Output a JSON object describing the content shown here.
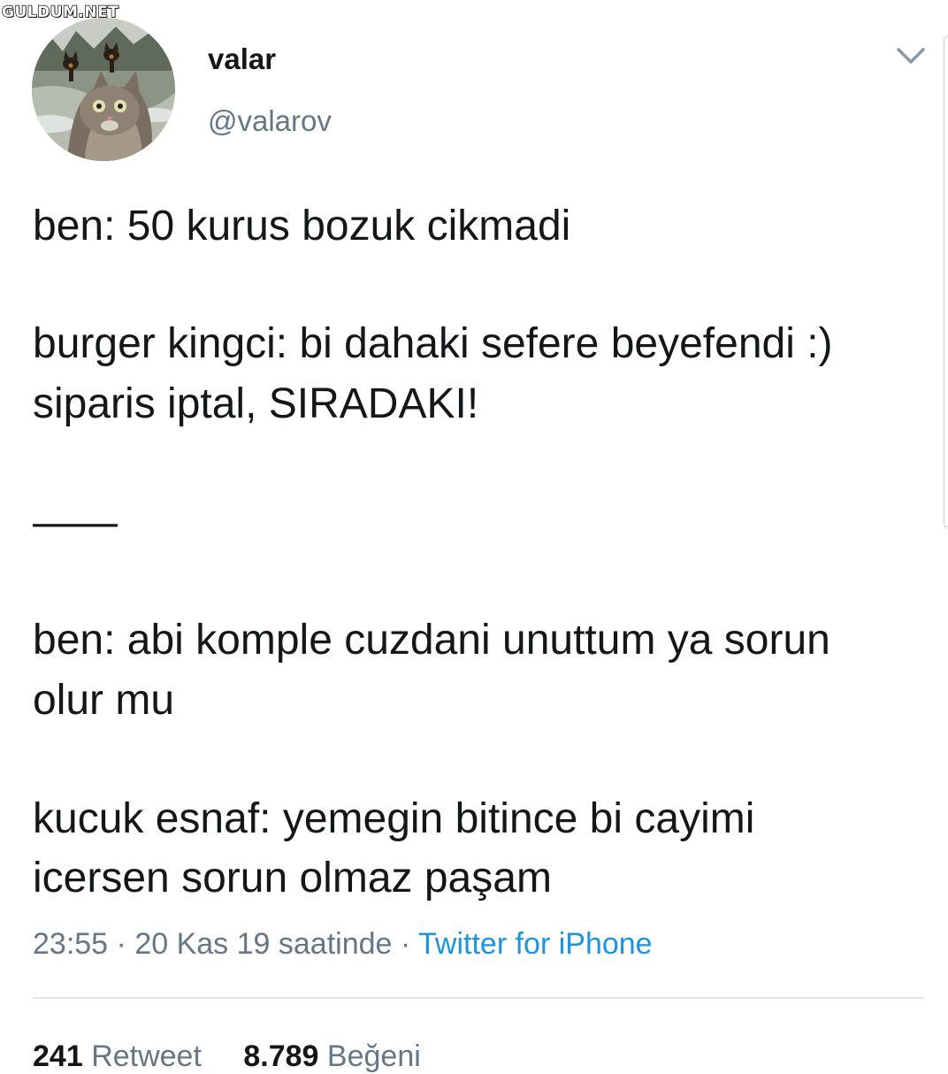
{
  "watermark": "GULDUM.NET",
  "user": {
    "display_name": "valar",
    "handle": "@valarov",
    "avatar_icon": "cat-selfie-avatar"
  },
  "tweet": {
    "lines": [
      "ben: 50 kurus bozuk cikmadi",
      "burger kingci: bi dahaki sefere beyefendi :)",
      "siparis iptal, SIRADAKI!",
      "——",
      "ben: abi komple cuzdani unuttum ya sorun",
      "olur mu",
      "kucuk esnaf: yemegin bitince bi cayimi",
      "icersen sorun olmaz paşam"
    ]
  },
  "meta": {
    "time": "23:55",
    "separator": " · ",
    "date": "20 Kas 19 saatinde",
    "source": "Twitter for iPhone"
  },
  "stats": {
    "retweets_count": "241",
    "retweets_label": "Retweet",
    "likes_count": "8.789",
    "likes_label": "Beğeni"
  },
  "colors": {
    "text": "#14171a",
    "secondary": "#657786",
    "link": "#1b95e0",
    "divider": "#e1e8ed"
  }
}
